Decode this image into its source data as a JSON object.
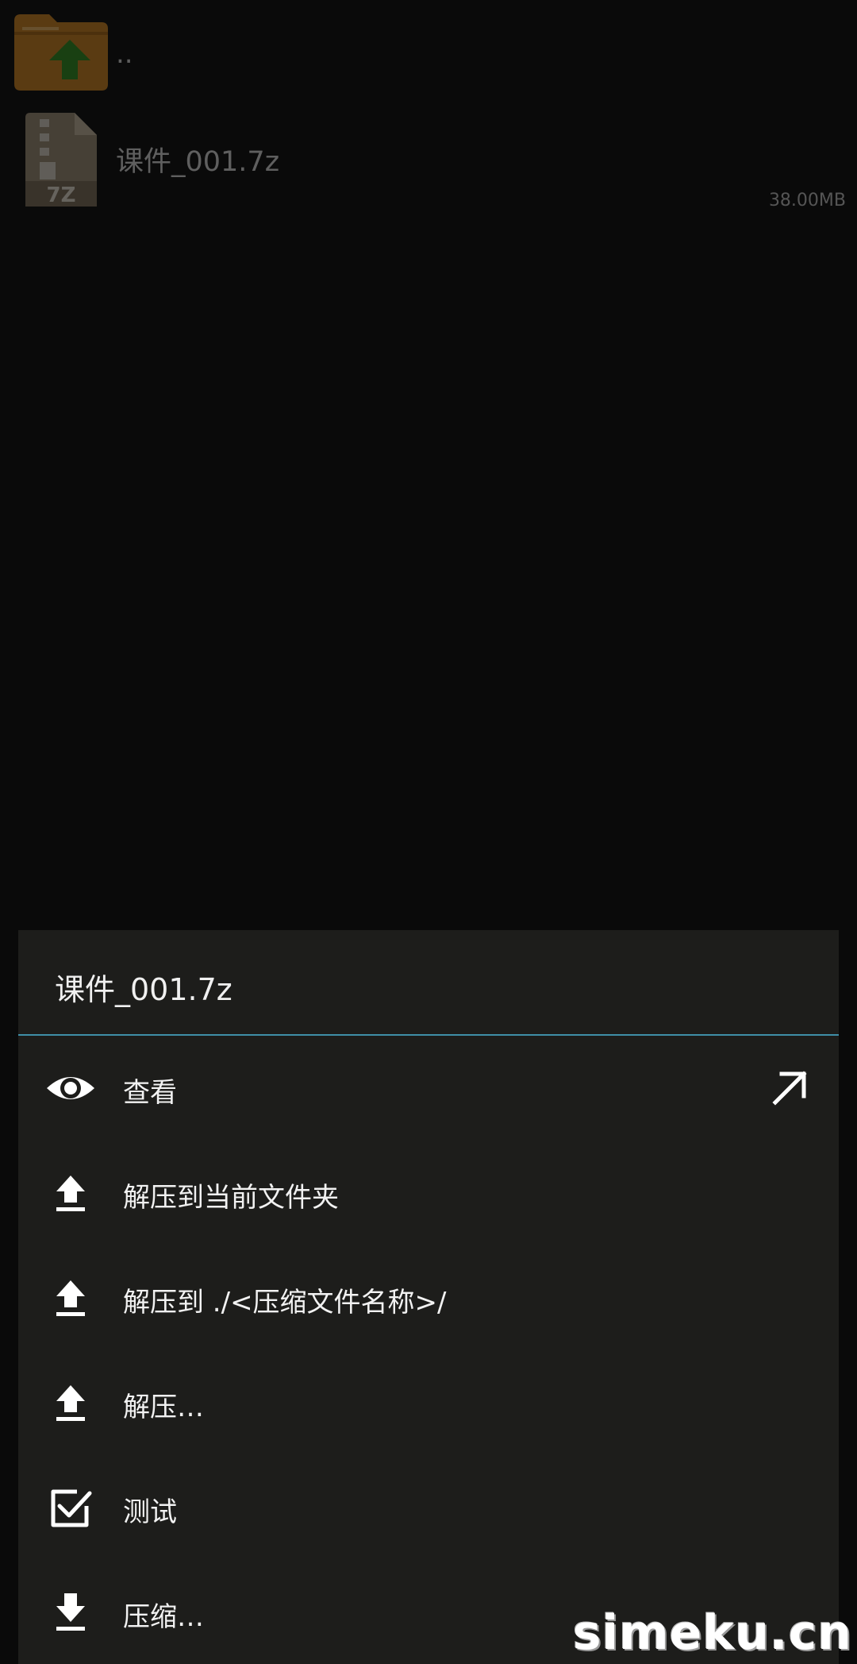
{
  "file_list": {
    "parent": {
      "name": "..",
      "icon": "folder-up-icon"
    },
    "archive": {
      "name": "课件_001.7z",
      "size": "38.00MB",
      "icon": "7z-archive-icon",
      "badge": "7Z"
    }
  },
  "menu": {
    "title": "课件_001.7z",
    "items": [
      {
        "label": "查看",
        "icon": "eye-icon",
        "trail_icon": "open-external-arrow-icon"
      },
      {
        "label": "解压到当前文件夹",
        "icon": "extract-up-icon"
      },
      {
        "label": "解压到 ./<压缩文件名称>/",
        "icon": "extract-up-icon"
      },
      {
        "label": "解压…",
        "icon": "extract-up-icon"
      },
      {
        "label": "测试",
        "icon": "checkbox-checked-icon"
      },
      {
        "label": "压缩…",
        "icon": "compress-down-icon"
      }
    ]
  },
  "watermark": "simeku.cn",
  "colors": {
    "background": "#0a0a0a",
    "menu_background": "#1d1d1b",
    "divider": "#3f8fa8",
    "folder": "#c8801e",
    "folder_arrow": "#2f8a1e"
  }
}
